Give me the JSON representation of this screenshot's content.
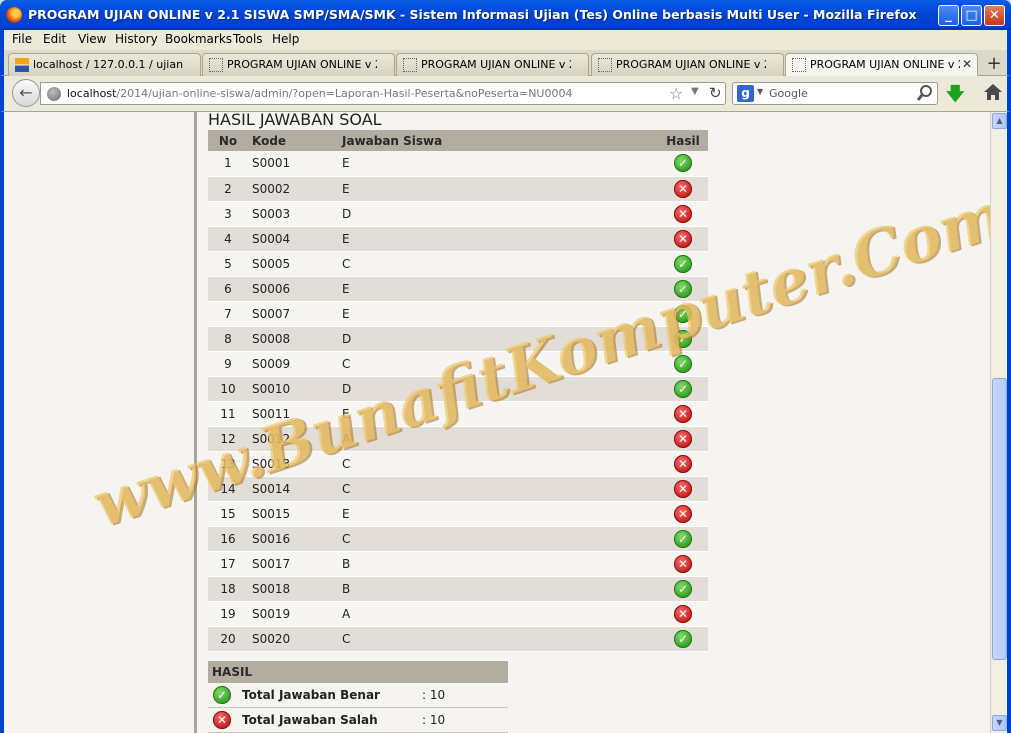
{
  "window": {
    "title": "PROGRAM UJIAN ONLINE v 2.1 SISWA SMP/SMA/SMK - Sistem Informasi Ujian (Tes) Online berbasis Multi User - Mozilla Firefox",
    "minimize": "_",
    "maximize": "□",
    "close": "✕"
  },
  "menu": [
    "File",
    "Edit",
    "View",
    "History",
    "Bookmarks",
    "Tools",
    "Help"
  ],
  "tabs": [
    {
      "label": "localhost / 127.0.0.1 / ujian_..."
    },
    {
      "label": "PROGRAM UJIAN ONLINE v 2..."
    },
    {
      "label": "PROGRAM UJIAN ONLINE v 2..."
    },
    {
      "label": "PROGRAM UJIAN ONLINE v 2..."
    },
    {
      "label": "PROGRAM UJIAN ONLINE v 2..."
    }
  ],
  "tab_close": "✕",
  "new_tab": "+",
  "nav": {
    "url_host": "localhost",
    "url_path": "/2014/ujian-online-siswa/admin/?open=Laporan-Hasil-Peserta&noPeserta=NU0004",
    "search_engine": "Google"
  },
  "page": {
    "section_title": "HASIL JAWABAN SOAL",
    "columns": {
      "no": "No",
      "kode": "Kode",
      "jawaban": "Jawaban Siswa",
      "hasil": "Hasil"
    },
    "rows": [
      {
        "no": "1",
        "kode": "S0001",
        "jawaban": "E",
        "benar": true
      },
      {
        "no": "2",
        "kode": "S0002",
        "jawaban": "E",
        "benar": false
      },
      {
        "no": "3",
        "kode": "S0003",
        "jawaban": "D",
        "benar": false
      },
      {
        "no": "4",
        "kode": "S0004",
        "jawaban": "E",
        "benar": false
      },
      {
        "no": "5",
        "kode": "S0005",
        "jawaban": "C",
        "benar": true
      },
      {
        "no": "6",
        "kode": "S0006",
        "jawaban": "E",
        "benar": true
      },
      {
        "no": "7",
        "kode": "S0007",
        "jawaban": "E",
        "benar": true
      },
      {
        "no": "8",
        "kode": "S0008",
        "jawaban": "D",
        "benar": true
      },
      {
        "no": "9",
        "kode": "S0009",
        "jawaban": "C",
        "benar": true
      },
      {
        "no": "10",
        "kode": "S0010",
        "jawaban": "D",
        "benar": true
      },
      {
        "no": "11",
        "kode": "S0011",
        "jawaban": "E",
        "benar": false
      },
      {
        "no": "12",
        "kode": "S0012",
        "jawaban": "A",
        "benar": false
      },
      {
        "no": "13",
        "kode": "S0013",
        "jawaban": "C",
        "benar": false
      },
      {
        "no": "14",
        "kode": "S0014",
        "jawaban": "C",
        "benar": false
      },
      {
        "no": "15",
        "kode": "S0015",
        "jawaban": "E",
        "benar": false
      },
      {
        "no": "16",
        "kode": "S0016",
        "jawaban": "C",
        "benar": true
      },
      {
        "no": "17",
        "kode": "S0017",
        "jawaban": "B",
        "benar": false
      },
      {
        "no": "18",
        "kode": "S0018",
        "jawaban": "B",
        "benar": true
      },
      {
        "no": "19",
        "kode": "S0019",
        "jawaban": "A",
        "benar": false
      },
      {
        "no": "20",
        "kode": "S0020",
        "jawaban": "C",
        "benar": true
      }
    ],
    "summary": {
      "heading": "HASIL",
      "benar_label": "Total Jawaban Benar",
      "benar_value": ": 10",
      "salah_label": "Total Jawaban Salah",
      "salah_value": ": 10"
    },
    "watermark": "www.BunafitKomputer.Com"
  },
  "icons": {
    "correct": "check-circle-icon",
    "wrong": "x-circle-icon"
  },
  "colors": {
    "titlebar": "#0041cd",
    "table_header": "#b3aca0",
    "row_even": "#e2ddd7",
    "correct": "#2e9a1f",
    "wrong": "#c11a1a"
  }
}
